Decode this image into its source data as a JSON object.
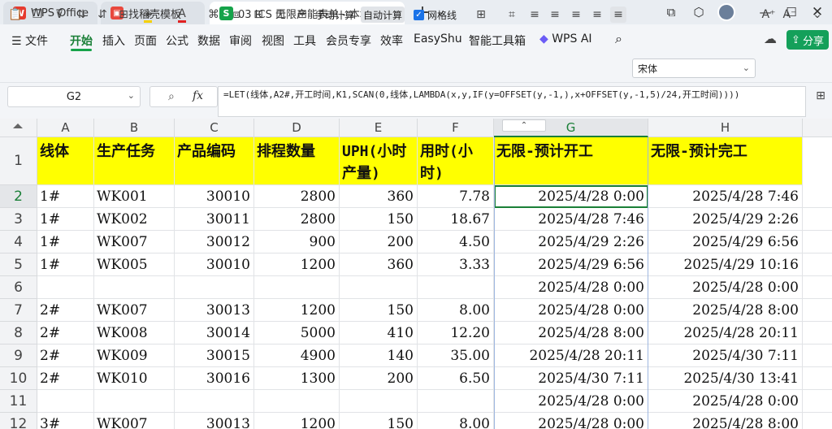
{
  "tabs": [
    {
      "label": "WPS Office",
      "icon": "wps-logo-icon"
    },
    {
      "label": "找稻壳模板",
      "icon": "docer-logo-icon"
    },
    {
      "label": "03 ICS 无限产能表单 - 本地.xlsx",
      "icon": "spreadsheet-logo-icon",
      "modified_marker": "●"
    }
  ],
  "menu": {
    "file": "文件",
    "items": [
      "开始",
      "插入",
      "页面",
      "公式",
      "数据",
      "审阅",
      "视图",
      "工具",
      "会员专享",
      "效率",
      "EasyShu",
      "智能工具箱"
    ],
    "ai": "WPS AI",
    "share": "分享"
  },
  "toolbar": {
    "manual_calc": "手动计算",
    "auto_calc": "自动计算",
    "gridlines": "网格线",
    "font_name": "宋体"
  },
  "formula_bar": {
    "cell_ref": "G2",
    "fx": "fx",
    "formula": "=LET(线体,A2#,开工时间,K1,SCAN(0,线体,LAMBDA(x,y,IF(y=OFFSET(y,-1,),x+OFFSET(y,-1,5)/24,开工时间))))"
  },
  "grid": {
    "collapse_label": "⌃",
    "columns": [
      "A",
      "B",
      "C",
      "D",
      "E",
      "F",
      "G",
      "H"
    ],
    "selected_column": "G",
    "headers": [
      "线体",
      "生产任务",
      "产品编码",
      "排程数量",
      "UPH(小时产量)",
      "用时(小时)",
      "无限-预计开工",
      "无限-预计完工"
    ],
    "rows": [
      {
        "n": "2",
        "a": "1#",
        "b": "WK001",
        "c": "30010",
        "d": "2800",
        "e": "360",
        "f": "7.78",
        "g": "2025/4/28  0:00",
        "h": "2025/4/28  7:46"
      },
      {
        "n": "3",
        "a": "1#",
        "b": "WK002",
        "c": "30011",
        "d": "2800",
        "e": "150",
        "f": "18.67",
        "g": "2025/4/28  7:46",
        "h": "2025/4/29  2:26"
      },
      {
        "n": "4",
        "a": "1#",
        "b": "WK007",
        "c": "30012",
        "d": "900",
        "e": "200",
        "f": "4.50",
        "g": "2025/4/29  2:26",
        "h": "2025/4/29  6:56"
      },
      {
        "n": "5",
        "a": "1#",
        "b": "WK005",
        "c": "30010",
        "d": "1200",
        "e": "360",
        "f": "3.33",
        "g": "2025/4/29  6:56",
        "h": "2025/4/29  10:16"
      },
      {
        "n": "6",
        "a": "",
        "b": "",
        "c": "",
        "d": "",
        "e": "",
        "f": "",
        "g": "2025/4/28  0:00",
        "h": "2025/4/28  0:00"
      },
      {
        "n": "7",
        "a": "2#",
        "b": "WK007",
        "c": "30013",
        "d": "1200",
        "e": "150",
        "f": "8.00",
        "g": "2025/4/28  0:00",
        "h": "2025/4/28  8:00"
      },
      {
        "n": "8",
        "a": "2#",
        "b": "WK008",
        "c": "30014",
        "d": "5000",
        "e": "410",
        "f": "12.20",
        "g": "2025/4/28  8:00",
        "h": "2025/4/28  20:11"
      },
      {
        "n": "9",
        "a": "2#",
        "b": "WK009",
        "c": "30015",
        "d": "4900",
        "e": "140",
        "f": "35.00",
        "g": "2025/4/28  20:11",
        "h": "2025/4/30  7:11"
      },
      {
        "n": "10",
        "a": "2#",
        "b": "WK010",
        "c": "30016",
        "d": "1300",
        "e": "200",
        "f": "6.50",
        "g": "2025/4/30  7:11",
        "h": "2025/4/30  13:41"
      },
      {
        "n": "11",
        "a": "",
        "b": "",
        "c": "",
        "d": "",
        "e": "",
        "f": "",
        "g": "2025/4/28  0:00",
        "h": "2025/4/28  0:00"
      },
      {
        "n": "12",
        "a": "3#",
        "b": "WK007",
        "c": "30013",
        "d": "1200",
        "e": "150",
        "f": "8.00",
        "g": "2025/4/28  0:00",
        "h": "2025/4/28  8:00"
      }
    ]
  },
  "colors": {
    "header_fill": "#ffff00",
    "accent": "#1a7f37",
    "share": "#14a05a"
  }
}
